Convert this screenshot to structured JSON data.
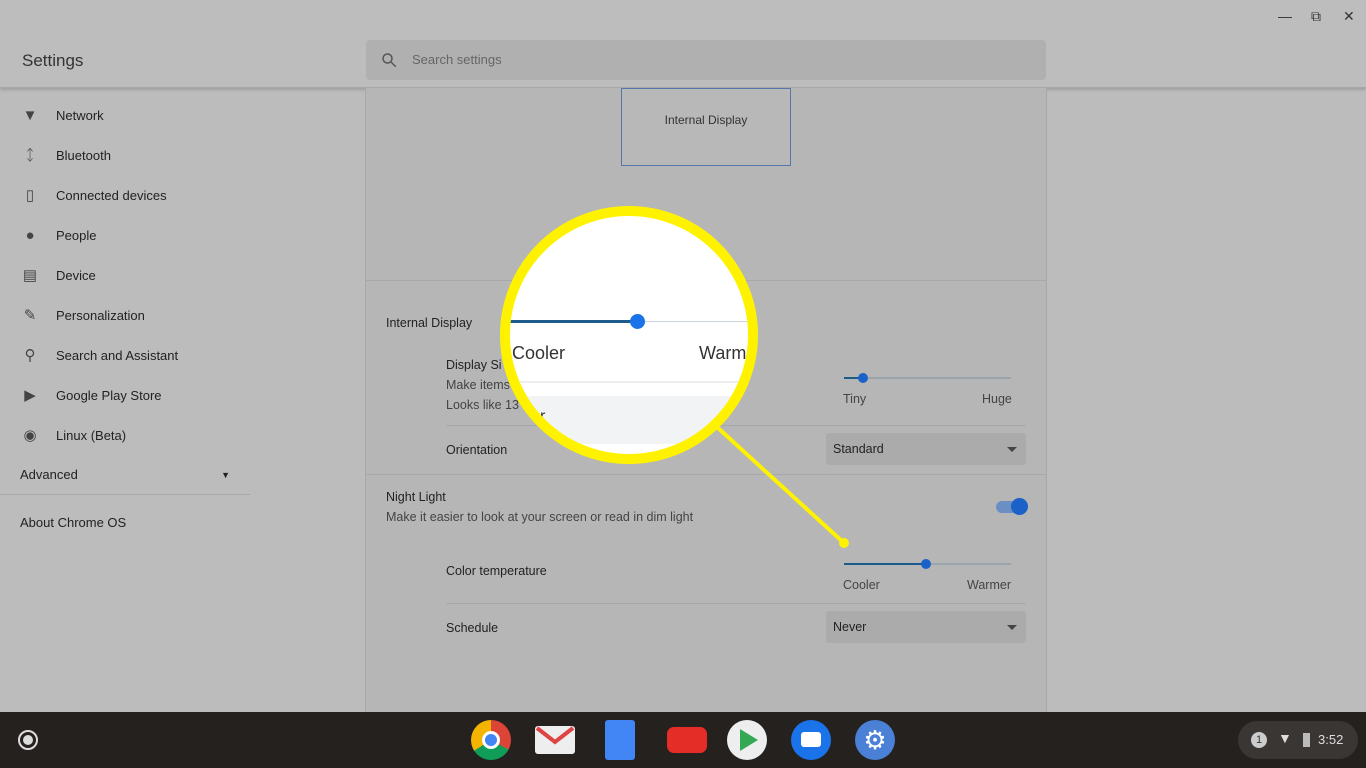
{
  "header": {
    "title": "Settings",
    "search_placeholder": "Search settings"
  },
  "sidebar": {
    "items": [
      {
        "label": "Network",
        "icon": "wifi-icon"
      },
      {
        "label": "Bluetooth",
        "icon": "bluetooth-icon"
      },
      {
        "label": "Connected devices",
        "icon": "phone-icon"
      },
      {
        "label": "People",
        "icon": "person-icon"
      },
      {
        "label": "Device",
        "icon": "laptop-icon"
      },
      {
        "label": "Personalization",
        "icon": "brush-icon"
      },
      {
        "label": "Search and Assistant",
        "icon": "search-icon"
      },
      {
        "label": "Google Play Store",
        "icon": "play-store-icon"
      },
      {
        "label": "Linux (Beta)",
        "icon": "linux-icon"
      }
    ],
    "advanced": "Advanced",
    "about": "About Chrome OS"
  },
  "main": {
    "display_box": "Internal Display",
    "internal_display": "Internal Display",
    "display_size": {
      "title": "Display Size",
      "desc": "Make items on your screen smaller or larger",
      "looks_like": "Looks like 1366 x 768",
      "min": "Tiny",
      "max": "Huge",
      "value_fraction": 0.1
    },
    "display_size_visible": {
      "title": "Display Si",
      "desc": "Make items",
      "looks_like": "Looks like 13"
    },
    "orientation": {
      "label": "Orientation",
      "value": "Standard"
    },
    "night_light": {
      "title": "Night Light",
      "desc": "Make it easier to look at your screen or read in dim light",
      "enabled": true
    },
    "color_temp": {
      "label": "Color temperature",
      "min": "Cooler",
      "max": "Warmer",
      "value_fraction": 0.5
    },
    "schedule": {
      "label": "Schedule",
      "value": "Never"
    }
  },
  "magnifier": {
    "cooler": "Cooler",
    "warmer": "Warm",
    "fragment": "r",
    "color": "#fff200"
  },
  "tray": {
    "notifications": "1",
    "time": "3:52"
  },
  "shelf": [
    "Chrome",
    "Gmail",
    "Docs",
    "YouTube",
    "Play Store",
    "Messages",
    "Settings"
  ]
}
